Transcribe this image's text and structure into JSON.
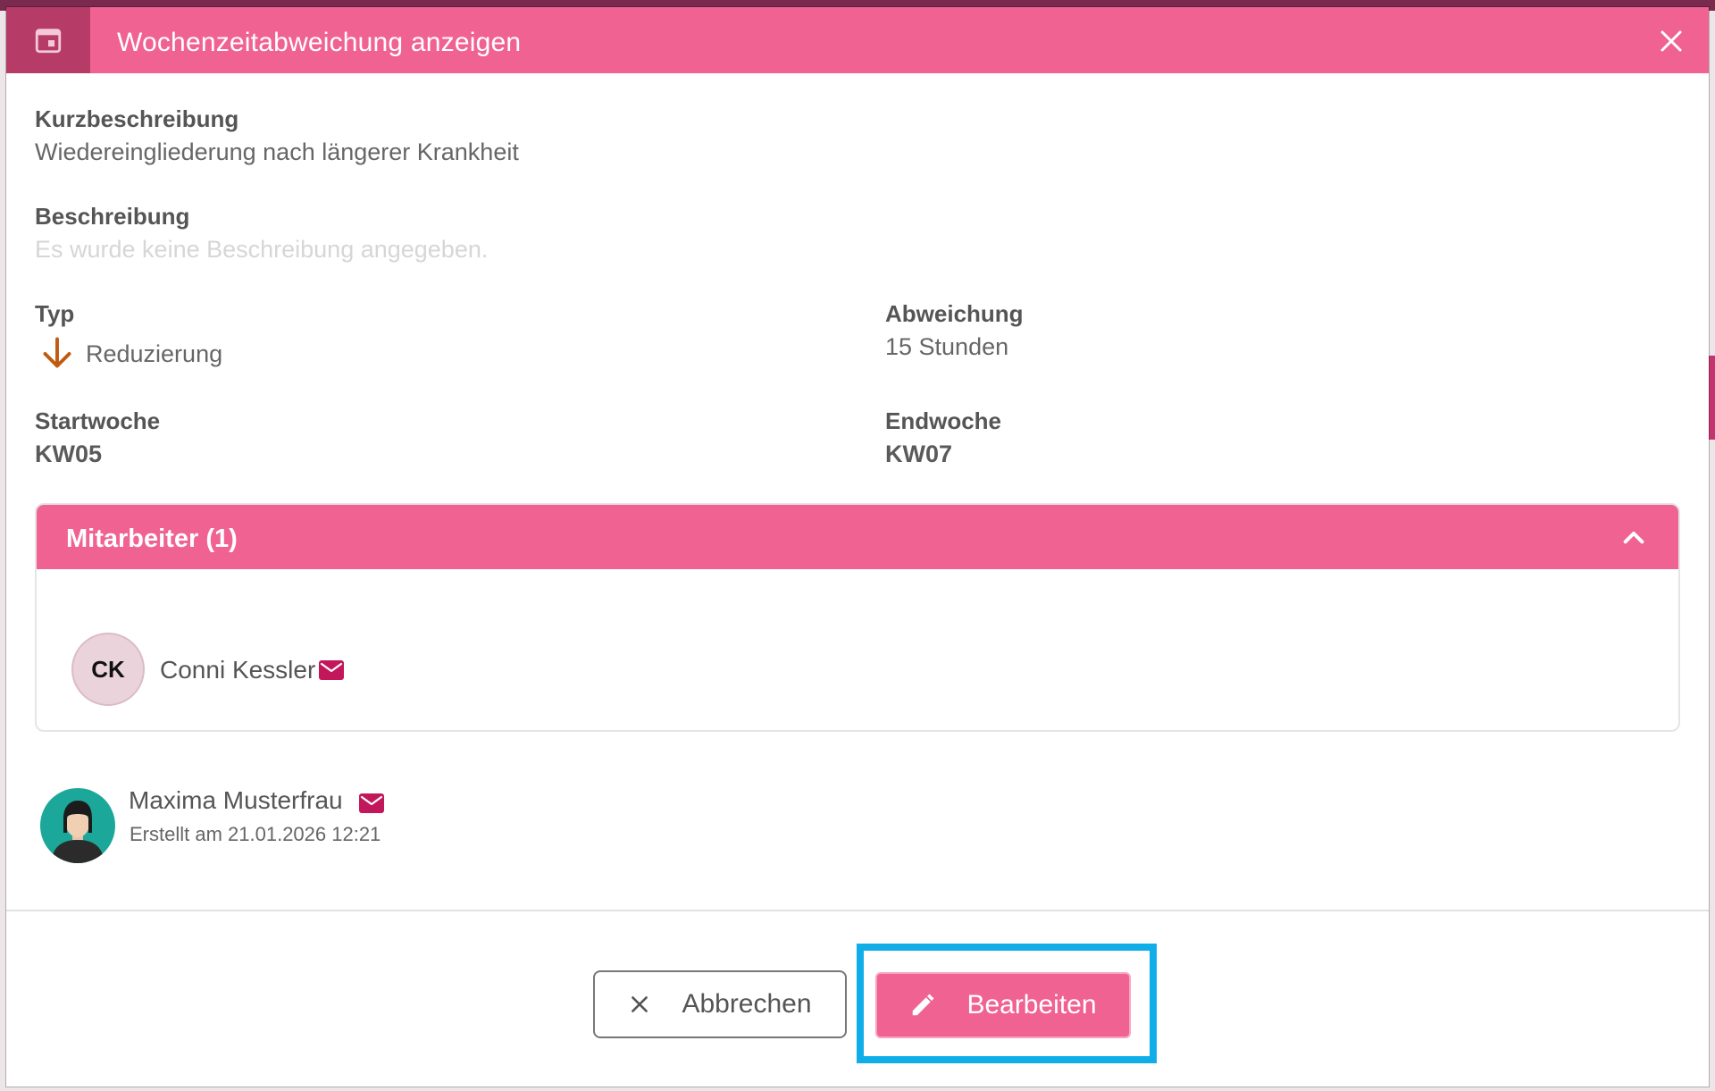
{
  "dialog": {
    "title": "Wochenzeitabweichung anzeigen"
  },
  "fields": {
    "kurzbeschreibung": {
      "label": "Kurzbeschreibung",
      "value": "Wiedereingliederung nach längerer Krankheit"
    },
    "beschreibung": {
      "label": "Beschreibung",
      "value": "Es wurde keine Beschreibung angegeben."
    },
    "typ": {
      "label": "Typ",
      "value": "Reduzierung"
    },
    "abweichung": {
      "label": "Abweichung",
      "value": "15 Stunden"
    },
    "startwoche": {
      "label": "Startwoche",
      "value": "KW05"
    },
    "endwoche": {
      "label": "Endwoche",
      "value": "KW07"
    }
  },
  "mitarbeiter": {
    "title": "Mitarbeiter (1)",
    "items": [
      {
        "initials": "CK",
        "name": "Conni Kessler"
      }
    ]
  },
  "creator": {
    "name": "Maxima Musterfrau",
    "created": "Erstellt am 21.01.2026 12:21"
  },
  "actions": {
    "cancel": "Abbrechen",
    "edit": "Bearbeiten"
  },
  "colors": {
    "accent": "#f06292",
    "accent_dark": "#b73b67",
    "highlight": "#10aee8",
    "arrow": "#c05a10",
    "mail": "#c2185b"
  }
}
